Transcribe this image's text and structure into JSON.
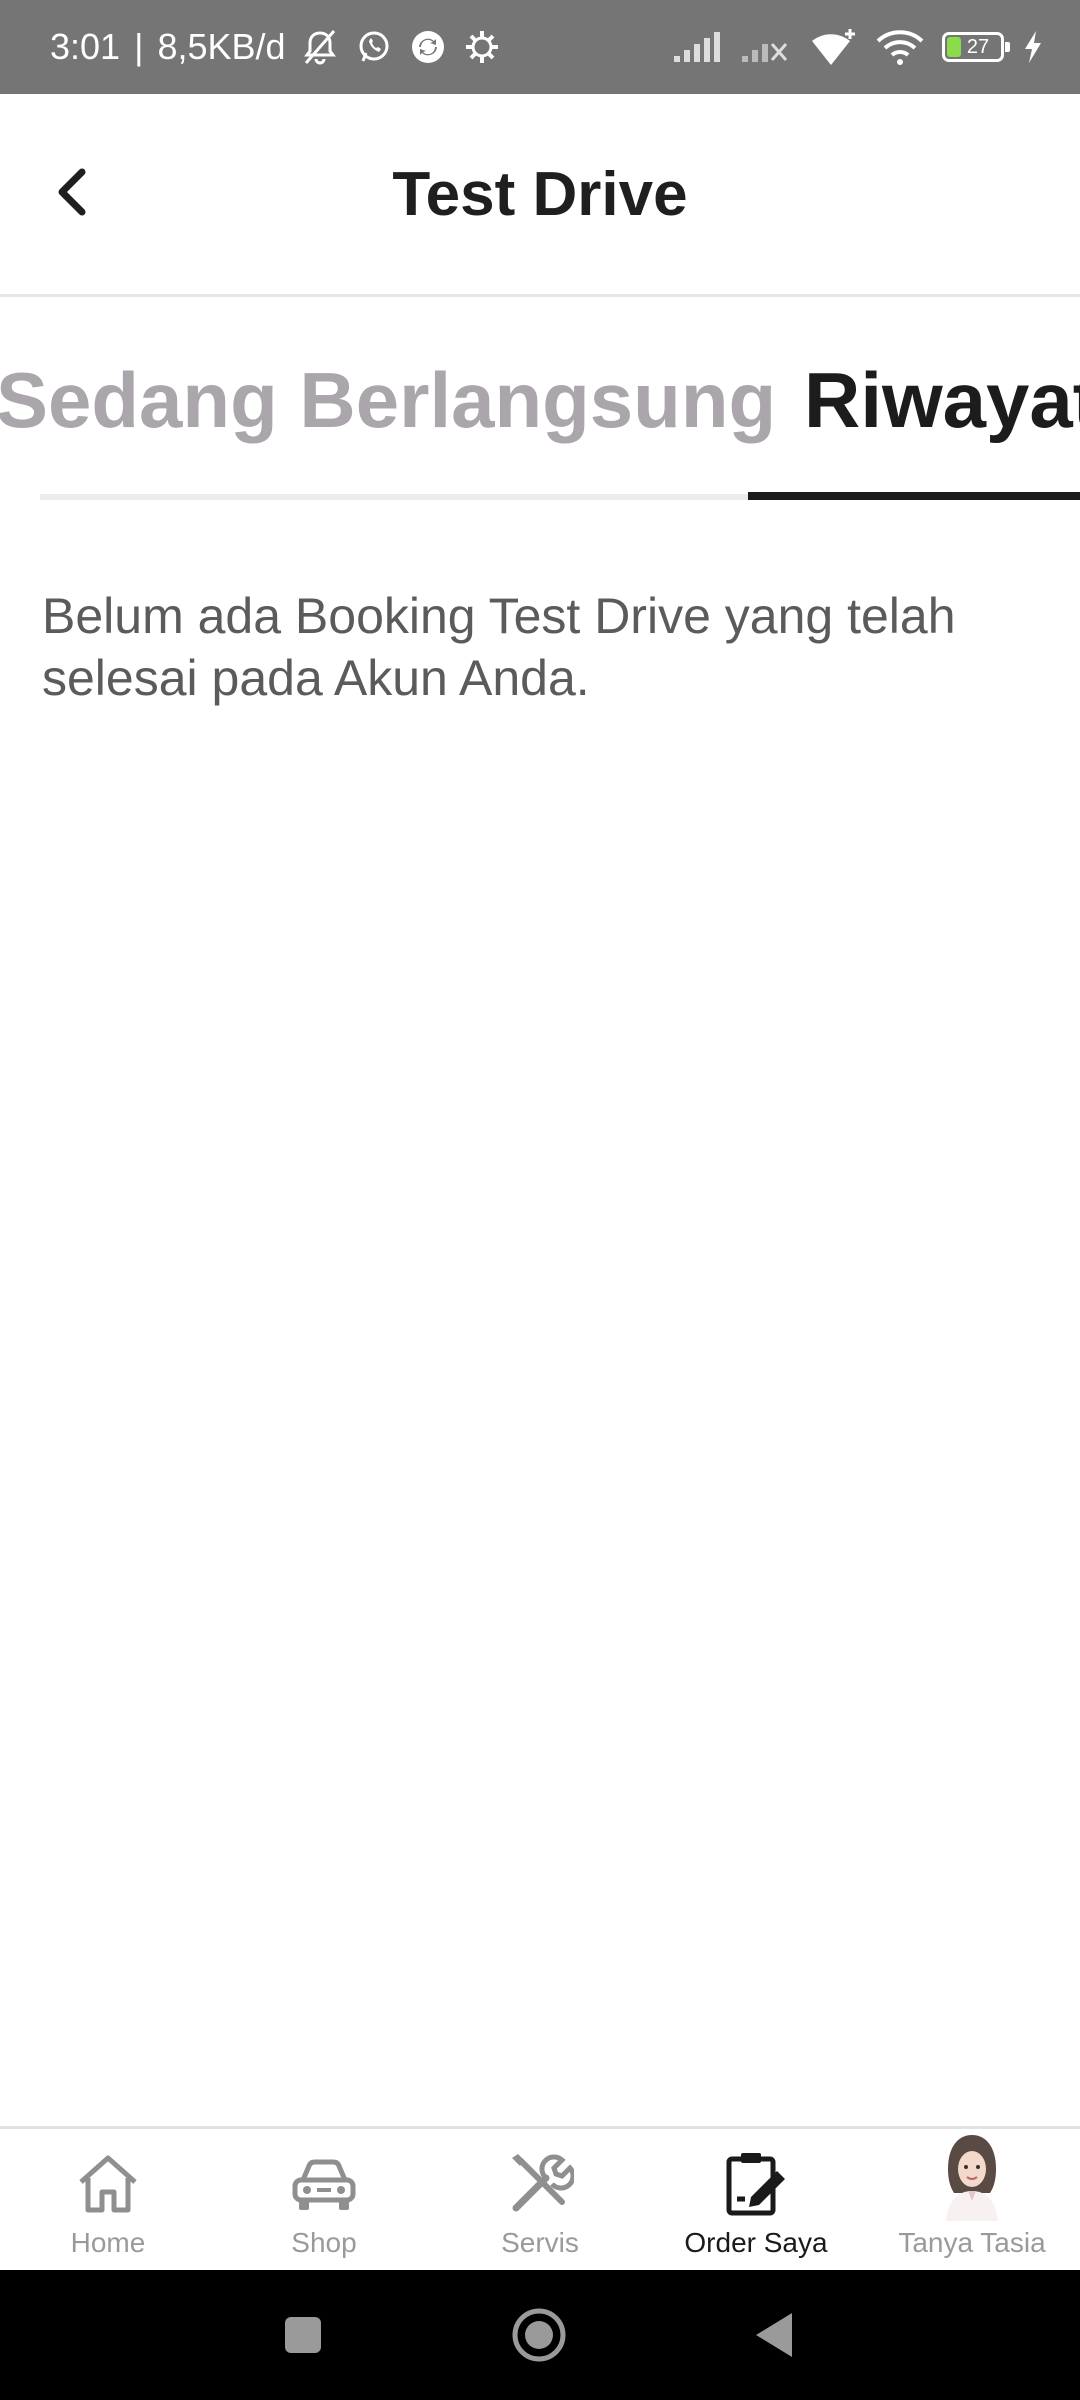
{
  "status_bar": {
    "time": "3:01",
    "separator": "|",
    "speed": "8,5KB/d",
    "battery": "27",
    "icons": [
      "bell-off-icon",
      "whatsapp-icon",
      "sync-icon",
      "settings-icon",
      "signal-icon",
      "signal-off-icon",
      "wifi-plus-icon",
      "wifi-icon",
      "battery-icon",
      "charging-icon"
    ]
  },
  "header": {
    "title": "Test Drive",
    "back_icon": "chevron-left-icon"
  },
  "tabs": [
    {
      "label": "Sedang Berlangsung",
      "active": false
    },
    {
      "label": "Riwayat",
      "active": true
    }
  ],
  "content": {
    "empty_message": "Belum ada Booking Test Drive yang telah selesai pada Akun Anda."
  },
  "bottom_nav": {
    "items": [
      {
        "label": "Home",
        "icon": "home-icon",
        "active": false
      },
      {
        "label": "Shop",
        "icon": "car-icon",
        "active": false
      },
      {
        "label": "Servis",
        "icon": "tools-icon",
        "active": false
      },
      {
        "label": "Order Saya",
        "icon": "clipboard-edit-icon",
        "active": true
      },
      {
        "label": "Tanya Tasia",
        "icon": "assistant-avatar-icon",
        "active": false
      }
    ]
  },
  "colors": {
    "status_bar": "#757575",
    "title": "#1f1f1f",
    "tab_active": "#1c1c1c",
    "tab_inactive": "#aaa6ab",
    "body_text": "#5b5b5b",
    "nav_inactive": "#9a9a9a",
    "battery_fill": "#8bdc4b"
  }
}
